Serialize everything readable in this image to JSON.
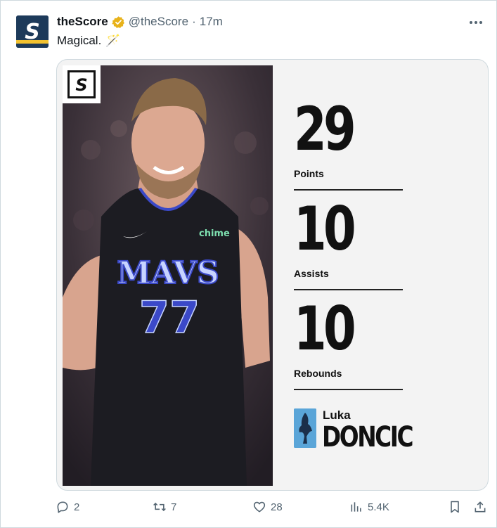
{
  "tweet": {
    "author_name": "theScore",
    "handle": "@theScore",
    "separator": "·",
    "time": "17m",
    "text": "Magical.",
    "emoji": "🪄"
  },
  "media": {
    "stats": [
      {
        "value": "29",
        "label": "Points"
      },
      {
        "value": "10",
        "label": "Assists"
      },
      {
        "value": "10",
        "label": "Rebounds"
      }
    ],
    "player_first": "Luka",
    "player_last": "DONCIC",
    "jersey_team": "MAVS",
    "jersey_number": "77",
    "jersey_sponsor": "chime",
    "logo_letter": "S"
  },
  "actions": {
    "replies": "2",
    "retweets": "7",
    "likes": "28",
    "views": "5.4K"
  },
  "colors": {
    "brand_navy": "#1d3a5a",
    "brand_yellow": "#f2c230",
    "verified_gold": "#e8b21a",
    "muted_text": "#536471",
    "mavs_blue": "#5aa5d8"
  }
}
